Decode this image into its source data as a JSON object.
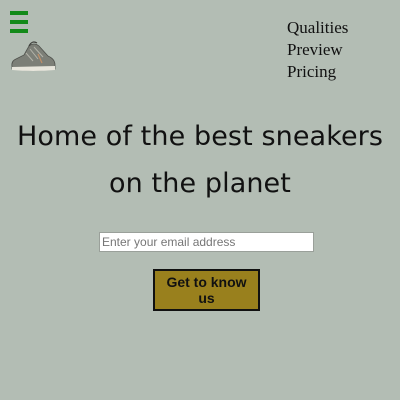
{
  "header": {
    "menu_icon": "hamburger-icon",
    "logo_icon": "sneaker-logo-icon",
    "nav": [
      "Qualities",
      "Preview",
      "Pricing"
    ]
  },
  "hero": {
    "title": "Home of the best sneakers on the planet"
  },
  "signup": {
    "email_placeholder": "Enter your email address",
    "email_value": "",
    "cta_label": "Get to know us"
  },
  "colors": {
    "background": "#b3bdb4",
    "menu_icon": "#138a19",
    "cta_background": "#99801d",
    "text": "#111111"
  }
}
